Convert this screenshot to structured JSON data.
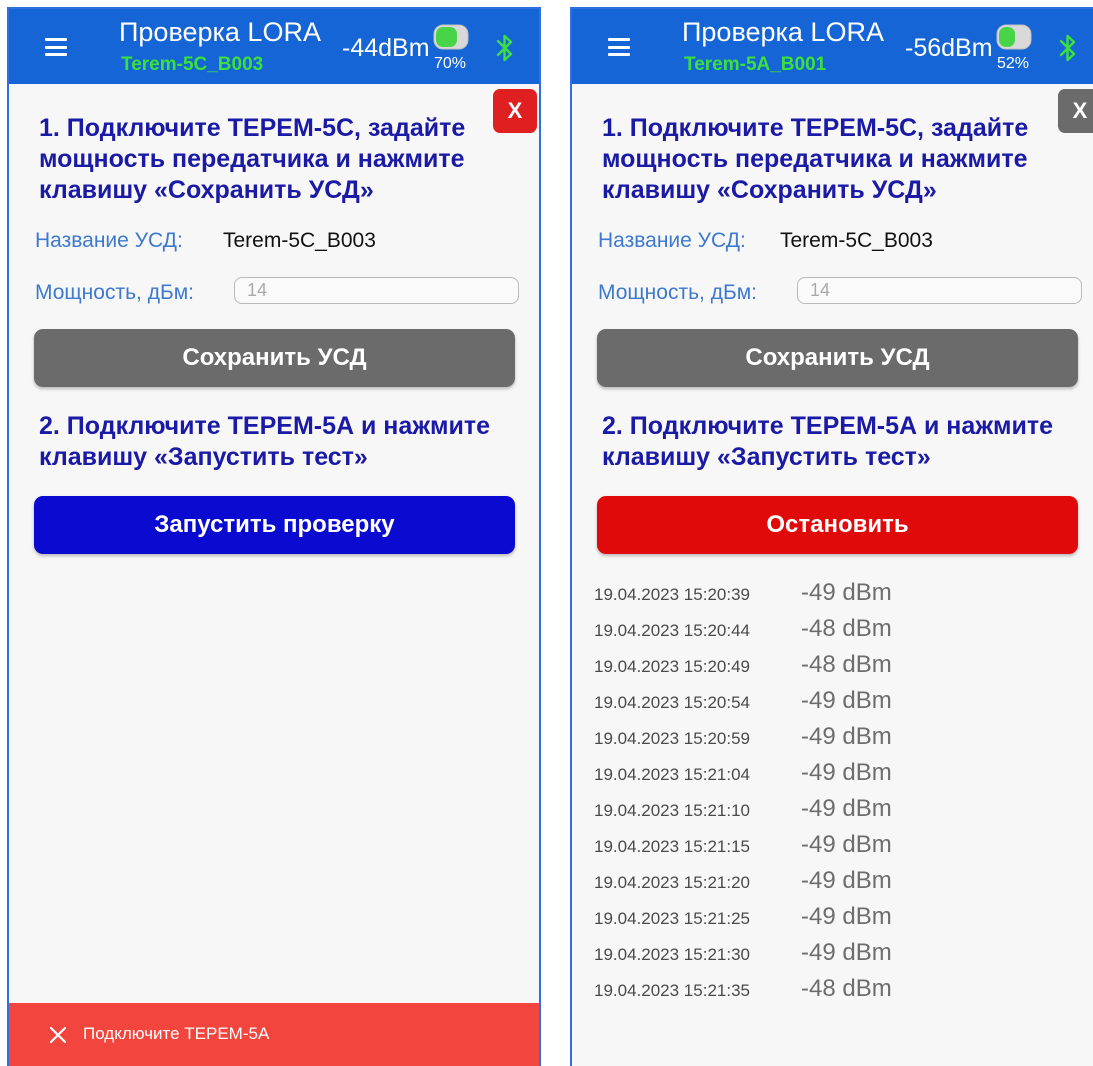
{
  "colors": {
    "appbar": "#1565d6",
    "subtitle": "#3ce03c",
    "step_text": "#1a1aa6",
    "label": "#3d79cf",
    "save_btn": "#6b6b6b",
    "start_btn": "#0a0ad0",
    "stop_btn": "#e00a0a",
    "snackbar": "#f2453d"
  },
  "left": {
    "header": {
      "title": "Проверка LORA",
      "device": "Terem-5C_B003",
      "rssi": "-44dBm",
      "battery_pct": "70%",
      "battery_level": 0.7,
      "menu_icon": "hamburger-menu-icon",
      "bt_icon": "bluetooth-icon"
    },
    "close_label": "X",
    "step1": "1. Подключите ТЕРЕМ-5С, задайте мощность передатчика и нажмите клавишу «Сохранить УСД»",
    "name_label": "Название УСД:",
    "name_value": "Terem-5C_B003",
    "power_label": "Мощность, дБм:",
    "power_placeholder": "14",
    "save_button": "Сохранить УСД",
    "step2": "2. Подключите ТЕРЕМ-5А и нажмите клавишу «Запустить тест»",
    "start_button": "Запустить проверку",
    "snackbar_text": "Подключите ТЕРЕМ-5А",
    "snackbar_icon": "close-icon"
  },
  "right": {
    "header": {
      "title": "Проверка LORA",
      "device": "Terem-5A_B001",
      "rssi": "-56dBm",
      "battery_pct": "52%",
      "battery_level": 0.52,
      "menu_icon": "hamburger-menu-icon",
      "bt_icon": "bluetooth-icon"
    },
    "close_label": "X",
    "step1": "1. Подключите ТЕРЕМ-5С, задайте мощность передатчика и нажмите клавишу «Сохранить УСД»",
    "name_label": "Название УСД:",
    "name_value": "Terem-5C_B003",
    "power_label": "Мощность, дБм:",
    "power_placeholder": "14",
    "save_button": "Сохранить УСД",
    "step2": "2. Подключите ТЕРЕМ-5А и нажмите клавишу «Запустить тест»",
    "stop_button": "Остановить",
    "log": [
      {
        "ts": "19.04.2023 15:20:39",
        "val": "-49 dBm"
      },
      {
        "ts": "19.04.2023 15:20:44",
        "val": "-48 dBm"
      },
      {
        "ts": "19.04.2023 15:20:49",
        "val": "-48 dBm"
      },
      {
        "ts": "19.04.2023 15:20:54",
        "val": "-49 dBm"
      },
      {
        "ts": "19.04.2023 15:20:59",
        "val": "-49 dBm"
      },
      {
        "ts": "19.04.2023 15:21:04",
        "val": "-49 dBm"
      },
      {
        "ts": "19.04.2023 15:21:10",
        "val": "-49 dBm"
      },
      {
        "ts": "19.04.2023 15:21:15",
        "val": "-49 dBm"
      },
      {
        "ts": "19.04.2023 15:21:20",
        "val": "-49 dBm"
      },
      {
        "ts": "19.04.2023 15:21:25",
        "val": "-49 dBm"
      },
      {
        "ts": "19.04.2023 15:21:30",
        "val": "-49 dBm"
      },
      {
        "ts": "19.04.2023 15:21:35",
        "val": "-48 dBm"
      }
    ]
  }
}
